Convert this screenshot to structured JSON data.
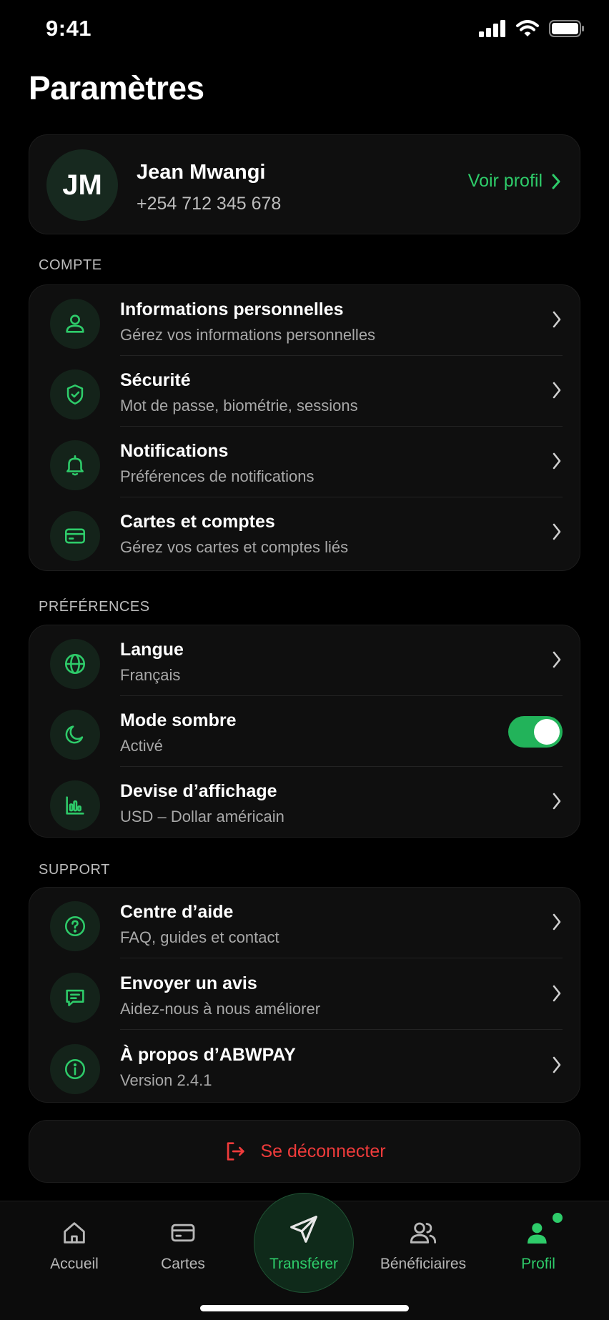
{
  "status": {
    "time": "9:41"
  },
  "page": {
    "title": "Paramètres"
  },
  "profile": {
    "initials": "JM",
    "name": "Jean Mwangi",
    "phone": "+254 712 345 678",
    "link_label": "Voir profil"
  },
  "sections": {
    "account": {
      "label": "COMPTE",
      "items": [
        {
          "title": "Informations personnelles",
          "subtitle": "Gérez vos informations personnelles",
          "icon": "user-icon"
        },
        {
          "title": "Sécurité",
          "subtitle": "Mot de passe, biométrie, sessions",
          "icon": "shield-check-icon"
        },
        {
          "title": "Notifications",
          "subtitle": "Préférences de notifications",
          "icon": "bell-icon"
        },
        {
          "title": "Cartes et comptes",
          "subtitle": "Gérez vos cartes et comptes liés",
          "icon": "credit-card-icon"
        }
      ]
    },
    "preferences": {
      "label": "PRÉFÉRENCES",
      "items": [
        {
          "title": "Langue",
          "subtitle": "Français",
          "icon": "globe-icon"
        },
        {
          "title": "Mode sombre",
          "subtitle": "Activé",
          "icon": "moon-icon",
          "toggle_on": true
        },
        {
          "title": "Devise d’affichage",
          "subtitle": "USD – Dollar américain",
          "icon": "chart-icon"
        }
      ]
    },
    "support": {
      "label": "SUPPORT",
      "items": [
        {
          "title": "Centre d’aide",
          "subtitle": "FAQ, guides et contact",
          "icon": "help-icon"
        },
        {
          "title": "Envoyer un avis",
          "subtitle": "Aidez-nous à nous améliorer",
          "icon": "message-icon"
        },
        {
          "title": "À propos d’ABWPAY",
          "subtitle": "Version 2.4.1",
          "icon": "info-icon"
        }
      ]
    }
  },
  "logout": {
    "label": "Se déconnecter"
  },
  "tabs": [
    {
      "label": "Accueil",
      "icon": "home-icon"
    },
    {
      "label": "Cartes",
      "icon": "card-icon"
    },
    {
      "label": "Transférer",
      "icon": "send-icon"
    },
    {
      "label": "Bénéficiaires",
      "icon": "users-icon"
    },
    {
      "label": "Profil",
      "icon": "profile-icon",
      "active": true
    }
  ],
  "colors": {
    "accent": "#2ecc6a",
    "danger": "#ef3b3b",
    "background": "#000000",
    "card": "#0f0f0f"
  }
}
